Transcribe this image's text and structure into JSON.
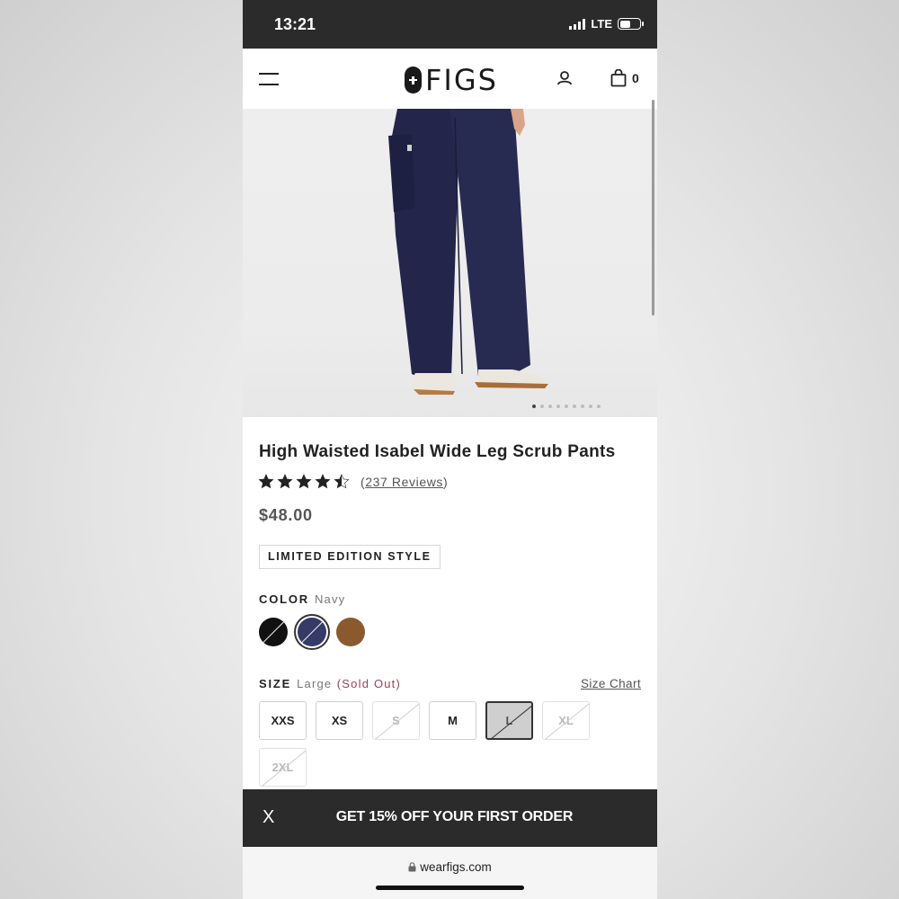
{
  "status_bar": {
    "time": "13:21",
    "network": "LTE"
  },
  "header": {
    "logo": "FIGS",
    "cart_count": "0",
    "icons": [
      "hamburger-menu-icon",
      "account-icon",
      "shopping-bag-icon"
    ]
  },
  "gallery": {
    "total_images": 9,
    "current_index": 0
  },
  "product": {
    "title": "High Waisted Isabel Wide Leg Scrub Pants",
    "rating": 4.5,
    "reviews_label": "237 Reviews",
    "price": "$48.00",
    "badge": "LIMITED EDITION STYLE",
    "color_label": "COLOR",
    "color_value": "Navy",
    "colors": [
      {
        "name": "Black",
        "hex": "#111111",
        "unavailable": true
      },
      {
        "name": "Navy",
        "hex": "#353a66",
        "unavailable": true,
        "selected": true
      },
      {
        "name": "Brown",
        "hex": "#8a5a2e",
        "unavailable": false
      }
    ],
    "size_label": "SIZE",
    "size_value": "Large",
    "size_status": "(Sold Out)",
    "size_chart_label": "Size Chart",
    "sizes": [
      {
        "label": "XXS",
        "available": true
      },
      {
        "label": "XS",
        "available": true
      },
      {
        "label": "S",
        "available": false
      },
      {
        "label": "M",
        "available": true
      },
      {
        "label": "L",
        "available": false,
        "selected": true
      },
      {
        "label": "XL",
        "available": false
      },
      {
        "label": "2XL",
        "available": false
      }
    ]
  },
  "promo": {
    "close": "X",
    "text": "GET 15% OFF YOUR FIRST ORDER"
  },
  "browser": {
    "url": "wearfigs.com"
  }
}
